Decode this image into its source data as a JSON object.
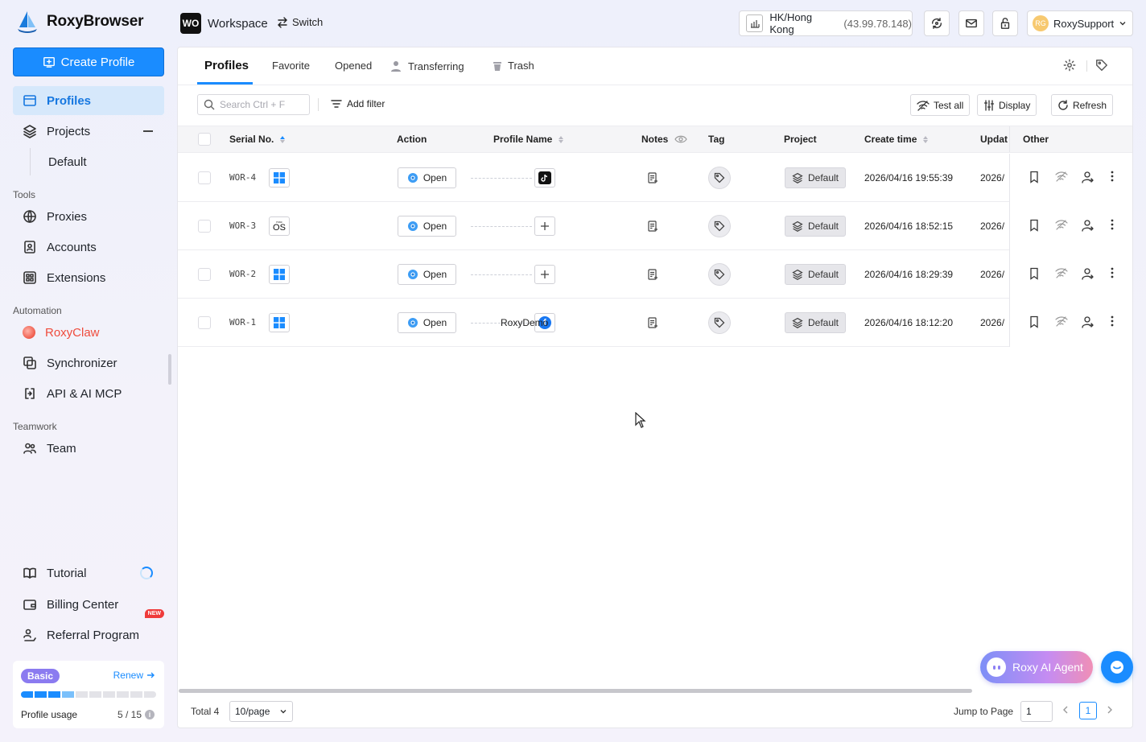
{
  "app": {
    "name": "RoxyBrowser"
  },
  "sidebar": {
    "create_button": "Create Profile",
    "profiles": "Profiles",
    "projects": "Projects",
    "default_project": "Default",
    "tools_label": "Tools",
    "proxies": "Proxies",
    "accounts": "Accounts",
    "extensions": "Extensions",
    "automation_label": "Automation",
    "roxyclaw": "RoxyClaw",
    "synchronizer": "Synchronizer",
    "api": "API & AI MCP",
    "teamwork_label": "Teamwork",
    "team": "Team",
    "tutorial": "Tutorial",
    "billing": "Billing Center",
    "referral": "Referral Program",
    "new_badge": "NEW",
    "plan": {
      "name": "Basic",
      "renew": "Renew",
      "usage_label": "Profile usage",
      "usage_value": "5 / 15",
      "used": 5,
      "total": 15
    }
  },
  "topbar": {
    "workspace_badge": "WO",
    "workspace_name": "Workspace",
    "switch_label": "Switch",
    "location": "HK/Hong Kong",
    "ip": "(43.99.78.148)",
    "user_initials": "RG",
    "user_name": "RoxySupport"
  },
  "tabs": {
    "profiles": "Profiles",
    "favorite": "Favorite",
    "opened": "Opened",
    "transferring": "Transferring",
    "trash": "Trash"
  },
  "toolbar": {
    "search_placeholder": "Search Ctrl + F",
    "add_filter": "Add filter",
    "test_all": "Test all",
    "display": "Display",
    "refresh": "Refresh"
  },
  "table": {
    "headers": {
      "serial": "Serial No.",
      "action": "Action",
      "profile_name": "Profile Name",
      "notes": "Notes",
      "tag": "Tag",
      "project": "Project",
      "create_time": "Create time",
      "update_time": "Updat",
      "other": "Other"
    },
    "rows": [
      {
        "serial": "WOR-4",
        "os": "windows",
        "platform": "tiktok",
        "open": "Open",
        "name": "",
        "project": "Default",
        "created": "2026/04/16 19:55:39",
        "updated": "2026/"
      },
      {
        "serial": "WOR-3",
        "os": "macos",
        "os_label": "OS",
        "platform": "add",
        "open": "Open",
        "name": "",
        "project": "Default",
        "created": "2026/04/16 18:52:15",
        "updated": "2026/"
      },
      {
        "serial": "WOR-2",
        "os": "windows",
        "platform": "add",
        "open": "Open",
        "name": "",
        "project": "Default",
        "created": "2026/04/16 18:29:39",
        "updated": "2026/"
      },
      {
        "serial": "WOR-1",
        "os": "windows",
        "platform": "facebook",
        "open": "Open",
        "name": "RoxyDemo",
        "project": "Default",
        "created": "2026/04/16 18:12:20",
        "updated": "2026/"
      }
    ]
  },
  "pagination": {
    "total": "Total 4",
    "page_size": "10/page",
    "jump_label": "Jump to Page",
    "jump_value": "1",
    "current": "1"
  },
  "floating": {
    "agent": "Roxy AI Agent"
  },
  "colors": {
    "accent": "#1a8cff",
    "active_nav_bg": "#d6e8fb",
    "plan_badge": "#8b7bf0",
    "new_badge": "#ef3b3b"
  }
}
